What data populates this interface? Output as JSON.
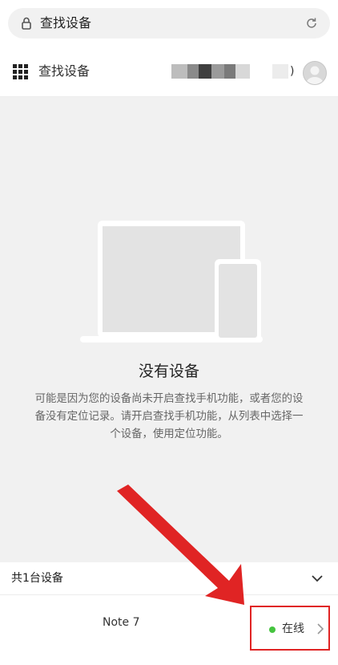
{
  "browser": {
    "url_text": "查找设备",
    "icons": {
      "lock": "lock-icon",
      "reload": "reload-icon"
    }
  },
  "header": {
    "title": "查找设备",
    "account_suffix": ")",
    "icons": {
      "menu": "grid-menu-icon",
      "avatar": "avatar"
    }
  },
  "empty_state": {
    "title": "没有设备",
    "description": "可能是因为您的设备尚未开启查找手机功能，或者您的设备没有定位记录。请开启查找手机功能，从列表中选择一个设备，使用定位功能。"
  },
  "devices": {
    "count_label": "共1台设备",
    "items": [
      {
        "name": "Note 7",
        "status": "在线",
        "status_color": "#45c43f"
      }
    ]
  },
  "colors": {
    "accent_red": "#e02424",
    "online_green": "#45c43f",
    "background_gray": "#f1f1f1"
  }
}
